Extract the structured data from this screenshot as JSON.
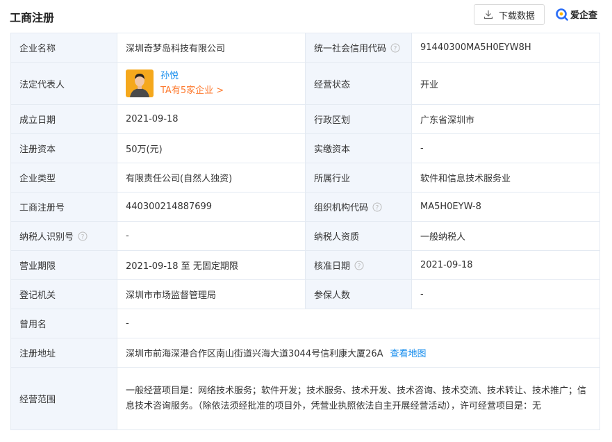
{
  "header": {
    "title": "工商注册",
    "download_label": "下载数据",
    "brand": "爱企查"
  },
  "rows": {
    "company_name": {
      "label": "企业名称",
      "value": "深圳奇梦岛科技有限公司"
    },
    "credit_code": {
      "label": "统一社会信用代码",
      "value": "91440300MA5H0EYW8H"
    },
    "legal_rep": {
      "label": "法定代表人",
      "name": "孙悦",
      "companies": "TA有5家企业 >"
    },
    "status": {
      "label": "经营状态",
      "value": "开业"
    },
    "founded": {
      "label": "成立日期",
      "value": "2021-09-18"
    },
    "region": {
      "label": "行政区划",
      "value": "广东省深圳市"
    },
    "reg_capital": {
      "label": "注册资本",
      "value": "50万(元)"
    },
    "paid_capital": {
      "label": "实缴资本",
      "value": "-"
    },
    "company_type": {
      "label": "企业类型",
      "value": "有限责任公司(自然人独资)"
    },
    "industry": {
      "label": "所属行业",
      "value": "软件和信息技术服务业"
    },
    "reg_no": {
      "label": "工商注册号",
      "value": "440300214887699"
    },
    "org_code": {
      "label": "组织机构代码",
      "value": "MA5H0EYW-8"
    },
    "taxpayer_id": {
      "label": "纳税人识别号",
      "value": "-"
    },
    "taxpayer_qual": {
      "label": "纳税人资质",
      "value": "一般纳税人"
    },
    "term": {
      "label": "营业期限",
      "value": "2021-09-18 至 无固定期限"
    },
    "approval_date": {
      "label": "核准日期",
      "value": "2021-09-18"
    },
    "authority": {
      "label": "登记机关",
      "value": "深圳市市场监督管理局"
    },
    "insured": {
      "label": "参保人数",
      "value": "-"
    },
    "former_name": {
      "label": "曾用名",
      "value": "-"
    },
    "address": {
      "label": "注册地址",
      "value": "深圳市前海深港合作区南山街道兴海大道3044号信利康大厦26A",
      "map_link": "查看地图"
    },
    "scope": {
      "label": "经营范围",
      "value": "一般经营项目是：网络技术服务；软件开发；技术服务、技术开发、技术咨询、技术交流、技术转让、技术推广；信息技术咨询服务。（除依法须经批准的项目外，凭营业执照依法自主开展经营活动），许可经营项目是：无"
    }
  },
  "colors": {
    "label_bg": "#f2f6fc",
    "border": "#e4eaf2",
    "link": "#128bed",
    "accent_orange": "#fd7a2f"
  }
}
